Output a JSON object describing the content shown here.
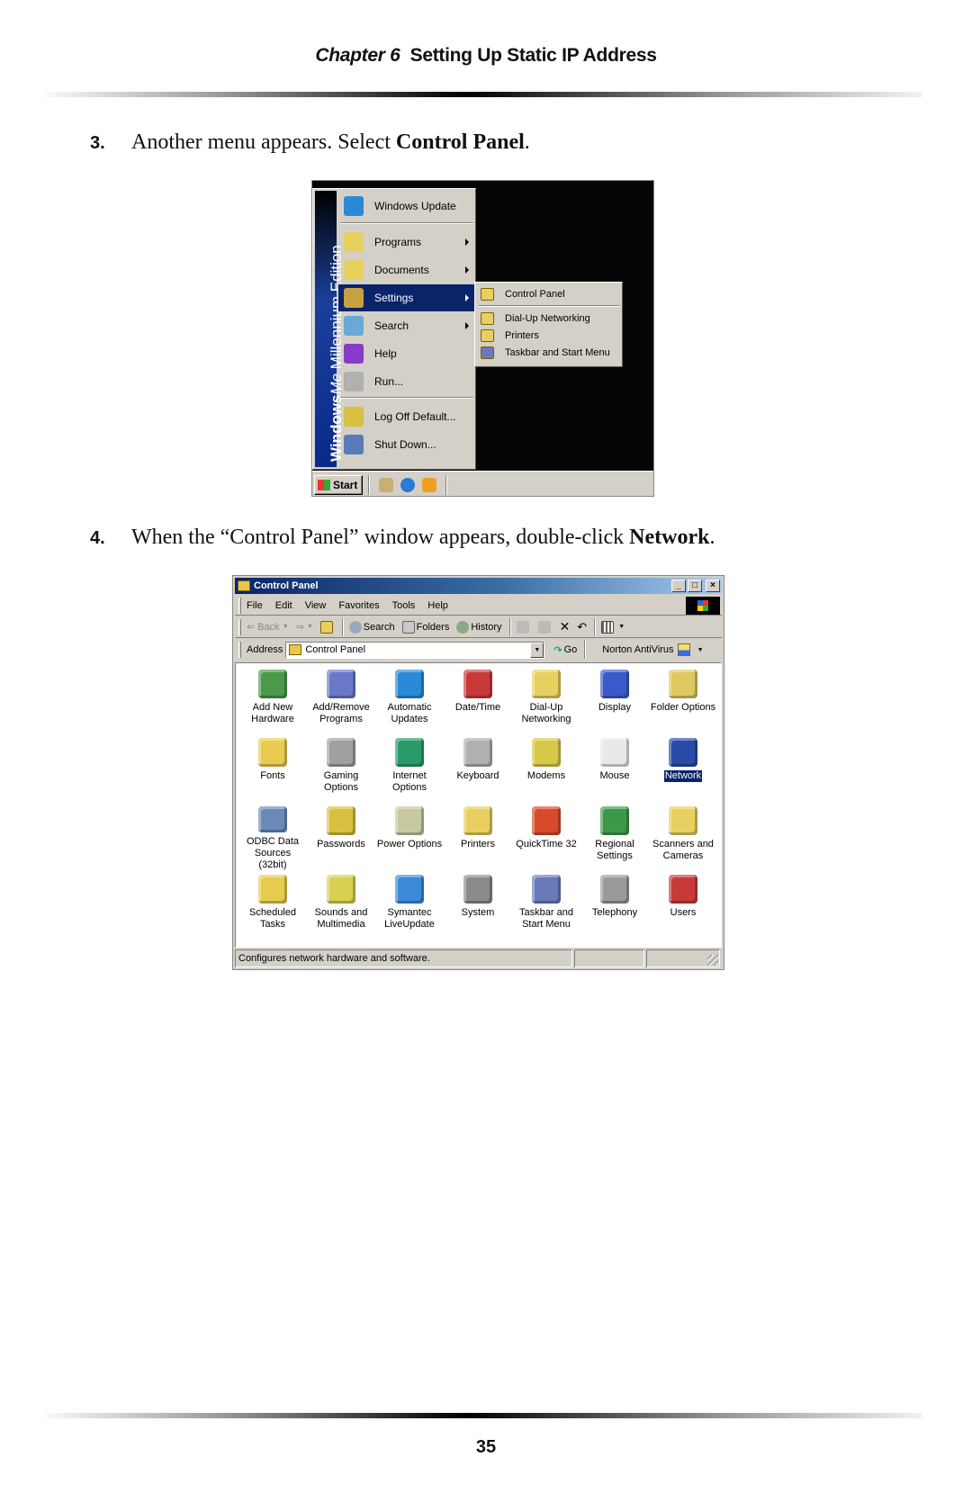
{
  "header": {
    "chapter_label": "Chapter 6",
    "chapter_title": "Setting Up Static IP Address"
  },
  "steps": [
    {
      "number": "3.",
      "text_before": "Another menu appears. Select ",
      "bold": "Control Panel",
      "text_after": "."
    },
    {
      "number": "4.",
      "text_before": "When the “Control Panel” window appears, double-click ",
      "bold": "Network",
      "text_after": "."
    }
  ],
  "start_menu_screenshot": {
    "banner": {
      "brand": "Windows",
      "edition": "Me",
      "suffix": "Millennium Edition"
    },
    "items": [
      {
        "label": "Windows Update",
        "icon": "windows-update-icon",
        "submenu": false
      },
      {
        "label": "Programs",
        "icon": "programs-icon",
        "submenu": true
      },
      {
        "label": "Documents",
        "icon": "documents-icon",
        "submenu": true
      },
      {
        "label": "Settings",
        "icon": "settings-icon",
        "submenu": true,
        "selected": true
      },
      {
        "label": "Search",
        "icon": "search-icon",
        "submenu": true
      },
      {
        "label": "Help",
        "icon": "help-icon",
        "submenu": false
      },
      {
        "label": "Run...",
        "icon": "run-icon",
        "submenu": false
      },
      {
        "label": "Log Off Default...",
        "icon": "log-off-icon",
        "submenu": false
      },
      {
        "label": "Shut Down...",
        "icon": "shut-down-icon",
        "submenu": false
      }
    ],
    "settings_submenu": [
      {
        "label": "Control Panel",
        "icon": "control-panel-icon"
      },
      {
        "label": "Dial-Up Networking",
        "icon": "dialup-networking-icon"
      },
      {
        "label": "Printers",
        "icon": "printers-icon"
      },
      {
        "label": "Taskbar and Start Menu",
        "icon": "taskbar-icon"
      }
    ],
    "taskbar": {
      "start_label": "Start"
    }
  },
  "control_panel_screenshot": {
    "window_title": "Control Panel",
    "title_buttons": {
      "minimize": "_",
      "maximize": "□",
      "close": "×"
    },
    "menus": [
      "File",
      "Edit",
      "View",
      "Favorites",
      "Tools",
      "Help"
    ],
    "toolbar": {
      "back": "Back",
      "search": "Search",
      "folders": "Folders",
      "history": "History"
    },
    "address": {
      "label": "Address",
      "value": "Control Panel",
      "go": "Go",
      "norton": "Norton AntiVirus"
    },
    "items": [
      {
        "label": "Add New\nHardware",
        "icon": "add-hardware-icon",
        "color": "#4a9a4a"
      },
      {
        "label": "Add/Remove\nPrograms",
        "icon": "add-remove-programs-icon",
        "color": "#6a78c8"
      },
      {
        "label": "Automatic\nUpdates",
        "icon": "automatic-updates-icon",
        "color": "#2a8ad8"
      },
      {
        "label": "Date/Time",
        "icon": "date-time-icon",
        "color": "#c83a3a"
      },
      {
        "label": "Dial-Up\nNetworking",
        "icon": "dialup-networking-icon",
        "color": "#e8d060"
      },
      {
        "label": "Display",
        "icon": "display-icon",
        "color": "#3a5ac8"
      },
      {
        "label": "Folder Options",
        "icon": "folder-options-icon",
        "color": "#e0c860"
      },
      {
        "label": "Fonts",
        "icon": "fonts-icon",
        "color": "#e8cc50"
      },
      {
        "label": "Gaming\nOptions",
        "icon": "gaming-options-icon",
        "color": "#a0a0a0"
      },
      {
        "label": "Internet\nOptions",
        "icon": "internet-options-icon",
        "color": "#2a9a6a"
      },
      {
        "label": "Keyboard",
        "icon": "keyboard-icon",
        "color": "#b0b0b0"
      },
      {
        "label": "Modems",
        "icon": "modems-icon",
        "color": "#d8c848"
      },
      {
        "label": "Mouse",
        "icon": "mouse-icon",
        "color": "#e8e8e8"
      },
      {
        "label": "Network",
        "icon": "network-icon",
        "color": "#2a4aa8",
        "selected": true
      },
      {
        "label": "ODBC Data\nSources (32bit)",
        "icon": "odbc-icon",
        "color": "#6a8ab8"
      },
      {
        "label": "Passwords",
        "icon": "passwords-icon",
        "color": "#d8c040"
      },
      {
        "label": "Power Options",
        "icon": "power-options-icon",
        "color": "#c8c8a0"
      },
      {
        "label": "Printers",
        "icon": "printers-icon",
        "color": "#e8d060"
      },
      {
        "label": "QuickTime 32",
        "icon": "quicktime-icon",
        "color": "#d84a2a"
      },
      {
        "label": "Regional\nSettings",
        "icon": "regional-settings-icon",
        "color": "#3a9a4a"
      },
      {
        "label": "Scanners and\nCameras",
        "icon": "scanners-cameras-icon",
        "color": "#e8d060"
      },
      {
        "label": "Scheduled\nTasks",
        "icon": "scheduled-tasks-icon",
        "color": "#e8cc50"
      },
      {
        "label": "Sounds and\nMultimedia",
        "icon": "sounds-icon",
        "color": "#d8d050"
      },
      {
        "label": "Symantec\nLiveUpdate",
        "icon": "symantec-liveupdate-icon",
        "color": "#3a8ad8"
      },
      {
        "label": "System",
        "icon": "system-icon",
        "color": "#8a8a8a"
      },
      {
        "label": "Taskbar and\nStart Menu",
        "icon": "taskbar-start-menu-icon",
        "color": "#6a7ab8"
      },
      {
        "label": "Telephony",
        "icon": "telephony-icon",
        "color": "#9a9a9a"
      },
      {
        "label": "Users",
        "icon": "users-icon",
        "color": "#c83a3a"
      }
    ],
    "status_text": "Configures network hardware and software."
  },
  "page_number": "35"
}
